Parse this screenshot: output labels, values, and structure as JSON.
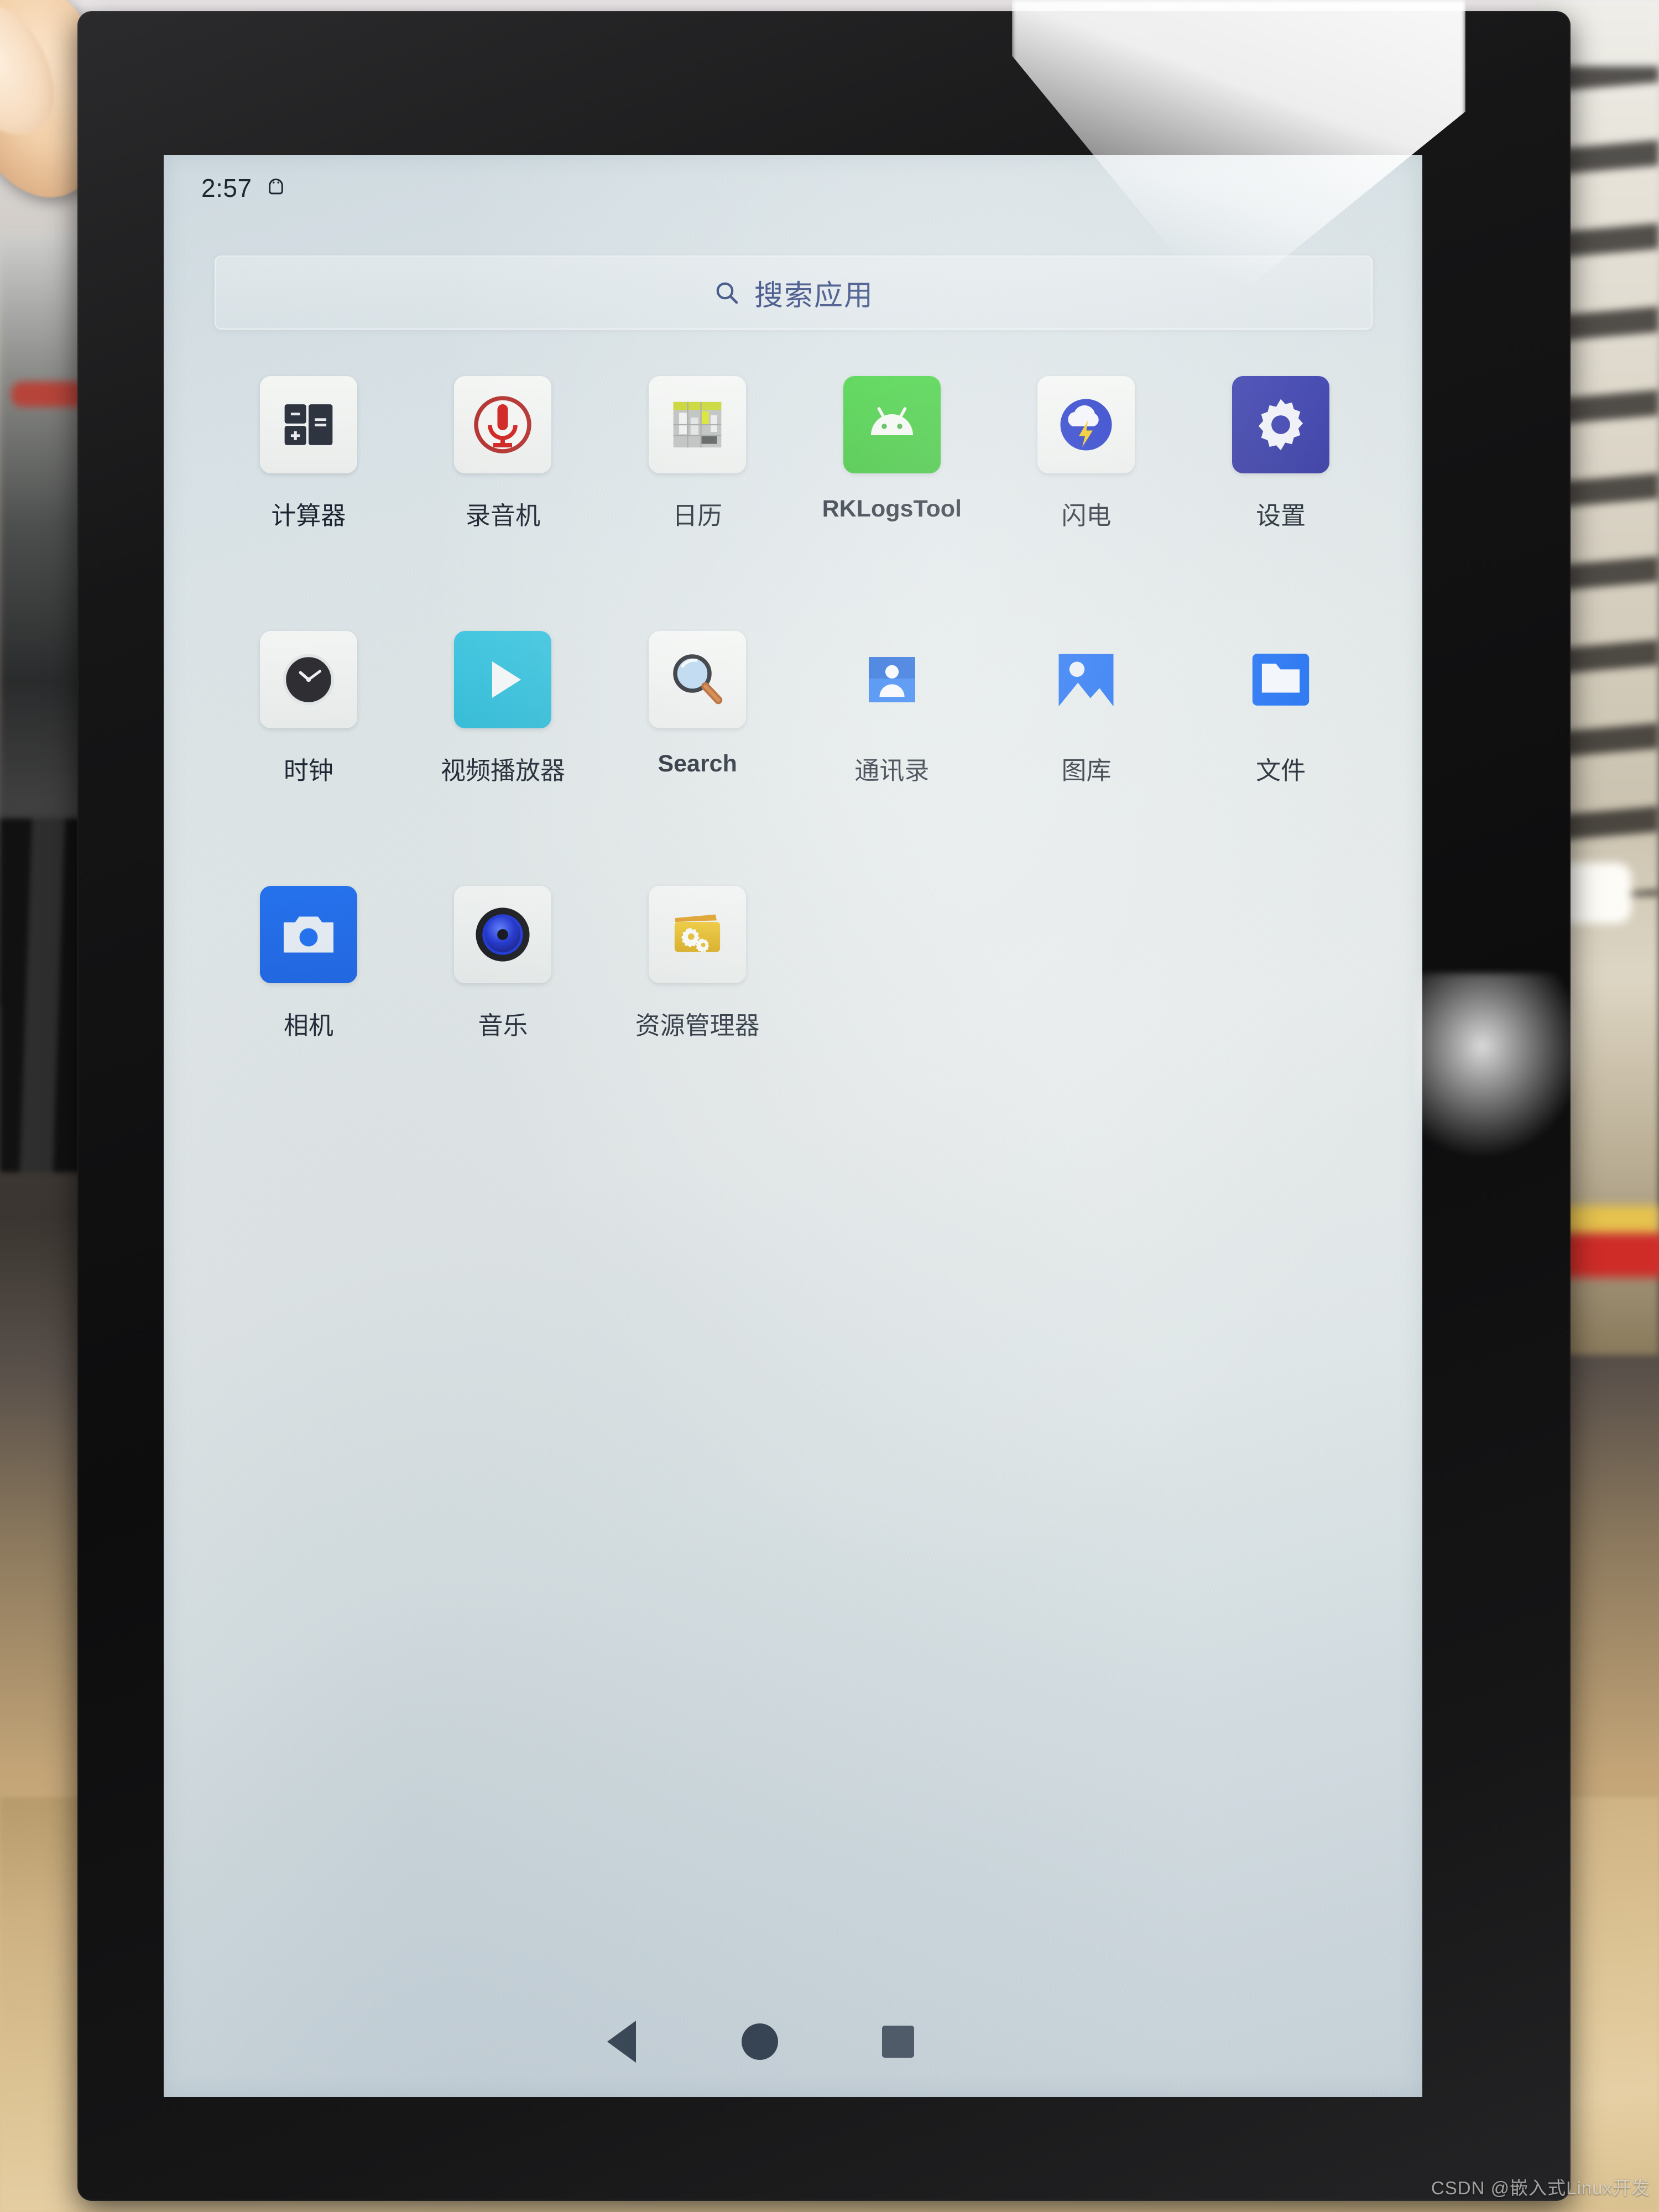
{
  "statusbar": {
    "time": "2:57",
    "bug_icon": "android-bug-icon"
  },
  "search": {
    "placeholder": "搜索应用",
    "icon": "search-icon"
  },
  "apps": [
    {
      "label": "计算器",
      "icon": "calculator-icon",
      "tile": "tile-white"
    },
    {
      "label": "录音机",
      "icon": "microphone-icon",
      "tile": "tile-white"
    },
    {
      "label": "日历",
      "icon": "calendar-icon",
      "tile": "tile-white"
    },
    {
      "label": "RKLogsTool",
      "icon": "android-icon",
      "tile": "tile-green"
    },
    {
      "label": "闪电",
      "icon": "lightning-cloud-icon",
      "tile": "tile-white"
    },
    {
      "label": "设置",
      "icon": "gear-icon",
      "tile": "tile-navy"
    },
    {
      "label": "时钟",
      "icon": "clock-icon",
      "tile": "tile-white"
    },
    {
      "label": "视频播放器",
      "icon": "play-icon",
      "tile": "tile-cyan"
    },
    {
      "label": "Search",
      "icon": "magnifier-icon",
      "tile": "tile-white"
    },
    {
      "label": "通讯录",
      "icon": "contacts-icon",
      "tile": "tile-none"
    },
    {
      "label": "图库",
      "icon": "gallery-icon",
      "tile": "tile-none"
    },
    {
      "label": "文件",
      "icon": "folder-icon",
      "tile": "tile-none"
    },
    {
      "label": "相机",
      "icon": "camera-icon",
      "tile": "tile-blue"
    },
    {
      "label": "音乐",
      "icon": "speaker-icon",
      "tile": "tile-white"
    },
    {
      "label": "资源管理器",
      "icon": "folder-gear-icon",
      "tile": "tile-white"
    }
  ],
  "navbar": {
    "back": "back-triangle-icon",
    "home": "home-circle-icon",
    "recent": "recents-square-icon"
  },
  "watermark": {
    "text": "CSDN @嵌入式Linux开发"
  },
  "colors": {
    "accent_blue": "#1f6ff0",
    "settings_navy": "#3a3fae",
    "android_green": "#39cf36",
    "video_cyan": "#3fc6e0",
    "recorder_red": "#c92a2a",
    "explorer_yellow": "#e8b81d",
    "screen_bg": "#dde5e7",
    "label_text": "#1b2430",
    "search_text": "#2b3f7a"
  }
}
